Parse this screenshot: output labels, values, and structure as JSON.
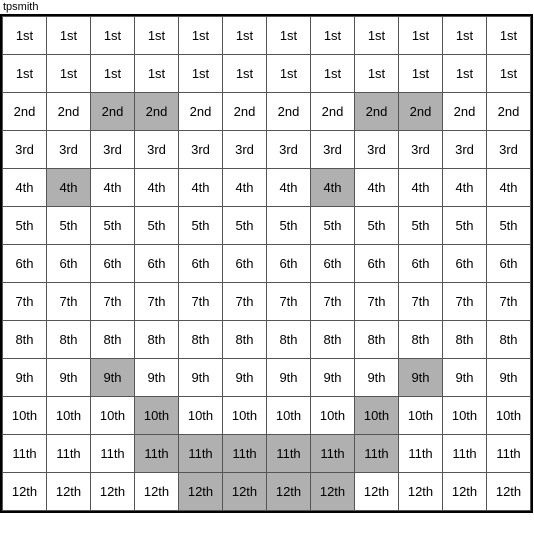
{
  "title": "tpsmith",
  "rows": [
    {
      "label": "1st",
      "highlights": [
        false,
        false,
        false,
        false,
        false,
        false,
        false,
        false,
        false,
        false,
        false,
        false
      ]
    },
    {
      "label": "2nd",
      "highlights": [
        false,
        false,
        true,
        true,
        false,
        false,
        false,
        false,
        true,
        true,
        false,
        false
      ]
    },
    {
      "label": "3rd",
      "highlights": [
        false,
        false,
        false,
        false,
        false,
        false,
        false,
        false,
        false,
        false,
        false,
        false
      ]
    },
    {
      "label": "4th",
      "highlights": [
        false,
        true,
        false,
        false,
        false,
        false,
        false,
        true,
        false,
        false,
        false,
        false
      ]
    },
    {
      "label": "5th",
      "highlights": [
        false,
        false,
        false,
        false,
        false,
        false,
        false,
        false,
        false,
        false,
        false,
        false
      ]
    },
    {
      "label": "6th",
      "highlights": [
        false,
        false,
        false,
        false,
        false,
        false,
        false,
        false,
        false,
        false,
        false,
        false
      ]
    },
    {
      "label": "7th",
      "highlights": [
        false,
        false,
        false,
        false,
        false,
        false,
        false,
        false,
        false,
        false,
        false,
        false
      ]
    },
    {
      "label": "8th",
      "highlights": [
        false,
        false,
        false,
        false,
        false,
        false,
        false,
        false,
        false,
        false,
        false,
        false
      ]
    },
    {
      "label": "9th",
      "highlights": [
        false,
        false,
        true,
        false,
        false,
        false,
        false,
        false,
        false,
        true,
        false,
        false
      ]
    },
    {
      "label": "10th",
      "highlights": [
        false,
        false,
        false,
        true,
        false,
        false,
        false,
        false,
        true,
        false,
        false,
        false
      ]
    },
    {
      "label": "11th",
      "highlights": [
        false,
        false,
        false,
        true,
        true,
        true,
        true,
        true,
        true,
        false,
        false,
        false
      ]
    },
    {
      "label": "12th",
      "highlights": [
        false,
        false,
        false,
        false,
        true,
        true,
        true,
        true,
        false,
        false,
        false,
        false
      ]
    }
  ],
  "cols": 12
}
